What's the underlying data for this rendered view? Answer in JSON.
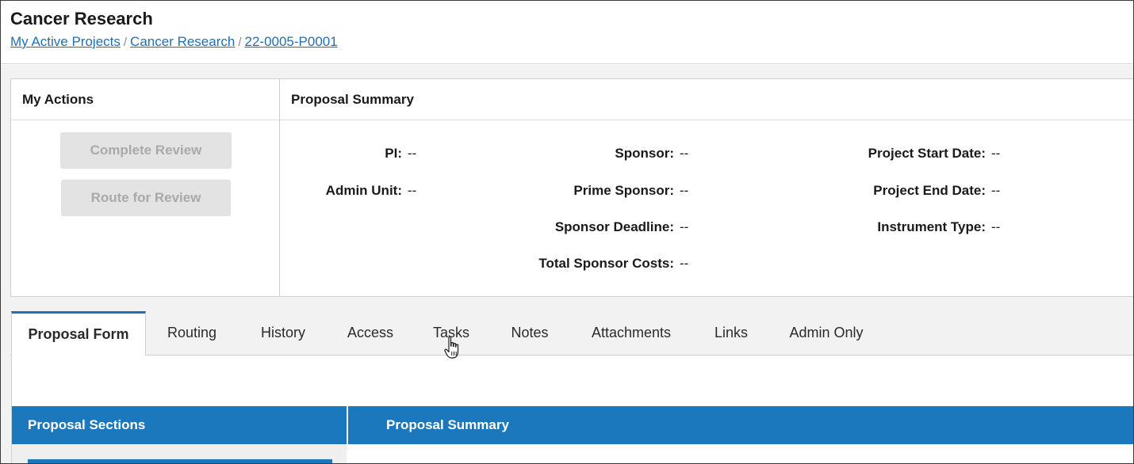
{
  "header": {
    "title": "Cancer Research",
    "breadcrumb": [
      {
        "label": "My Active Projects"
      },
      {
        "label": "Cancer Research"
      },
      {
        "label": "22-0005-P0001"
      }
    ],
    "separator": "/"
  },
  "actions": {
    "title": "My Actions",
    "complete_review": "Complete Review",
    "route_for_review": "Route for Review"
  },
  "summary": {
    "title": "Proposal Summary",
    "fields": {
      "pi": {
        "label": "PI:",
        "value": "--"
      },
      "admin_unit": {
        "label": "Admin Unit:",
        "value": "--"
      },
      "sponsor": {
        "label": "Sponsor:",
        "value": "--"
      },
      "prime_sponsor": {
        "label": "Prime Sponsor:",
        "value": "--"
      },
      "sponsor_deadline": {
        "label": "Sponsor Deadline:",
        "value": "--"
      },
      "total_sponsor_costs": {
        "label": "Total Sponsor Costs:",
        "value": "--"
      },
      "project_start_date": {
        "label": "Project Start Date:",
        "value": "--"
      },
      "project_end_date": {
        "label": "Project End Date:",
        "value": "--"
      },
      "instrument_type": {
        "label": "Instrument Type:",
        "value": "--"
      }
    }
  },
  "tabs": [
    {
      "label": "Proposal Form",
      "active": true
    },
    {
      "label": "Routing"
    },
    {
      "label": "History"
    },
    {
      "label": "Access"
    },
    {
      "label": "Tasks"
    },
    {
      "label": "Notes"
    },
    {
      "label": "Attachments"
    },
    {
      "label": "Links"
    },
    {
      "label": "Admin Only"
    }
  ],
  "content": {
    "sections_title": "Proposal Sections",
    "summary_title": "Proposal Summary"
  },
  "colors": {
    "accent": "#1b78bd",
    "link": "#1f6fb5",
    "disabled_button": "#e3e3e3"
  }
}
